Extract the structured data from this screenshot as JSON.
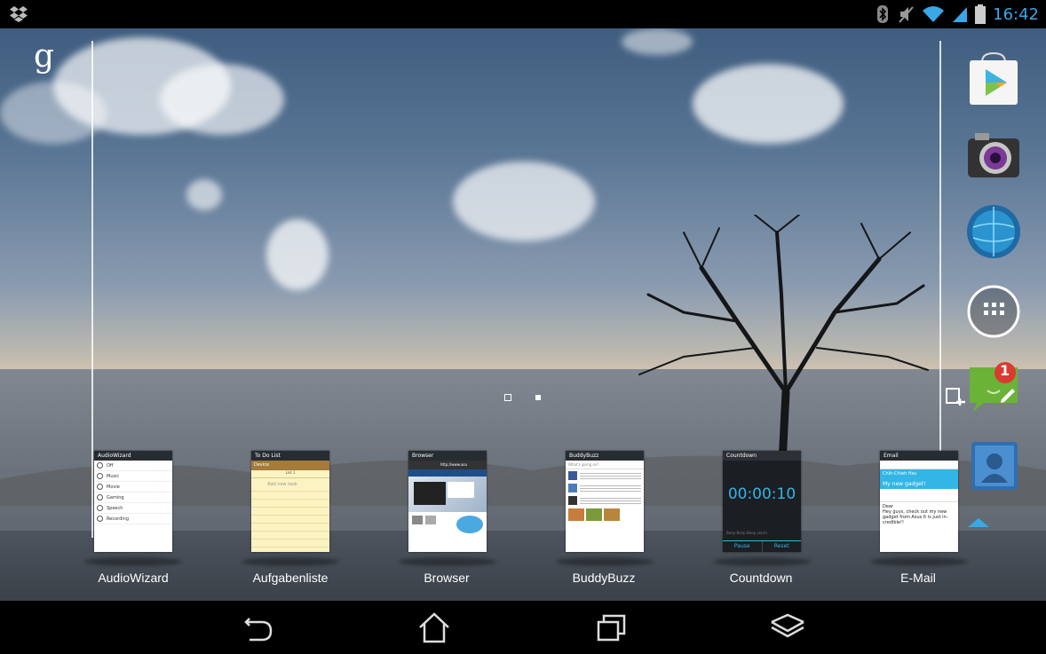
{
  "status": {
    "time": "16:42",
    "icons": [
      "dropbox-icon",
      "bluetooth-icon",
      "mute-icon",
      "wifi-icon",
      "signal-icon",
      "battery-icon"
    ]
  },
  "launcher": {
    "google_search": "g",
    "page_count": 2,
    "current_page": 2,
    "dock_icons": [
      "play-store-icon",
      "camera-icon",
      "browser-globe-icon",
      "all-apps-icon",
      "memo-widget-icon",
      "contacts-icon"
    ],
    "notification_badge": "1"
  },
  "recents": [
    {
      "label": "AudioWizard",
      "preview": {
        "title": "AudioWizard",
        "rows": [
          "Off",
          "Music",
          "Movie",
          "Gaming",
          "Speech",
          "Recording"
        ]
      }
    },
    {
      "label": "Aufgabenliste",
      "preview": {
        "title": "To Do List",
        "sub": "Device",
        "tab": "List 1",
        "placeholder": "Add new task"
      }
    },
    {
      "label": "Browser",
      "preview": {
        "title": "Browser",
        "url": "http://www.asu"
      }
    },
    {
      "label": "BuddyBuzz",
      "preview": {
        "title": "BuddyBuzz",
        "search": "What's going on?"
      }
    },
    {
      "label": "Countdown",
      "preview": {
        "title": "Countdown",
        "time": "00:00:10",
        "pause": "Pause",
        "reset": "Reset",
        "alert": "Beep Beep Beep alarm"
      }
    },
    {
      "label": "E-Mail",
      "preview": {
        "title": "Email",
        "from": "Chih-Chieh Hsu",
        "subject": "My new gadget!",
        "body": "Dear\nHey guys, check out my new gadget from Asus It is just in-credible!!"
      }
    }
  ],
  "colors": {
    "accent": "#33b5e5",
    "status_icon": "#3aa7e6"
  }
}
